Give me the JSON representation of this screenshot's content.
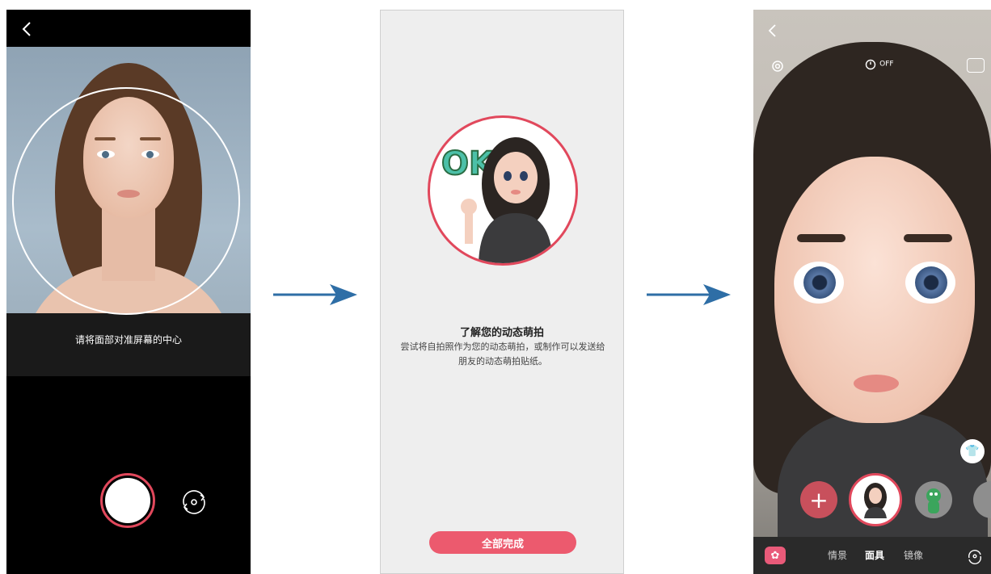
{
  "panel1": {
    "hint": "请将面部对准屏幕的中心"
  },
  "arrows": [
    "arrow-right-icon",
    "arrow-right-icon"
  ],
  "panel2": {
    "title": "了解您的动态萌拍",
    "description": "尝试将自拍照作为您的动态萌拍，或制作可以发送给朋友的动态萌拍贴纸。",
    "sticker_text": "OK",
    "done_button": "全部完成"
  },
  "panel3": {
    "timer_label": "OFF",
    "add_label": "+",
    "modes": [
      "情景",
      "面具",
      "镜像"
    ],
    "active_mode": "面具",
    "colors": {
      "accent": "#e1485c",
      "ar_button": "#e95a79"
    }
  }
}
